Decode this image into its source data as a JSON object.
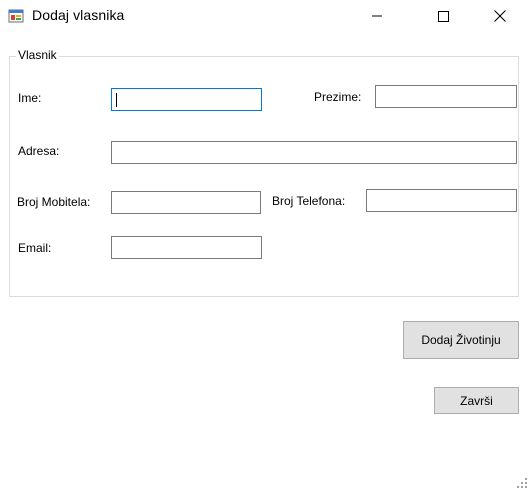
{
  "window": {
    "title": "Dodaj vlasnika",
    "app_icon": "form-window-icon",
    "controls": [
      "minimize-icon",
      "maximize-icon",
      "close-icon"
    ]
  },
  "group": {
    "title": "Vlasnik"
  },
  "fields": {
    "ime": {
      "label": "Ime:",
      "value": ""
    },
    "prezime": {
      "label": "Prezime:",
      "value": ""
    },
    "adresa": {
      "label": "Adresa:",
      "value": ""
    },
    "broj_mobitela": {
      "label": "Broj Mobitela:",
      "value": ""
    },
    "broj_telefona": {
      "label": "Broj Telefona:",
      "value": ""
    },
    "email": {
      "label": "Email:",
      "value": ""
    }
  },
  "buttons": {
    "dodaj_zivotinju": "Dodaj Životinju",
    "zavrsi": "Završi"
  },
  "colors": {
    "focus_border": "#0078d7",
    "button_face": "#e1e1e1",
    "input_border": "#7a7a7a"
  }
}
